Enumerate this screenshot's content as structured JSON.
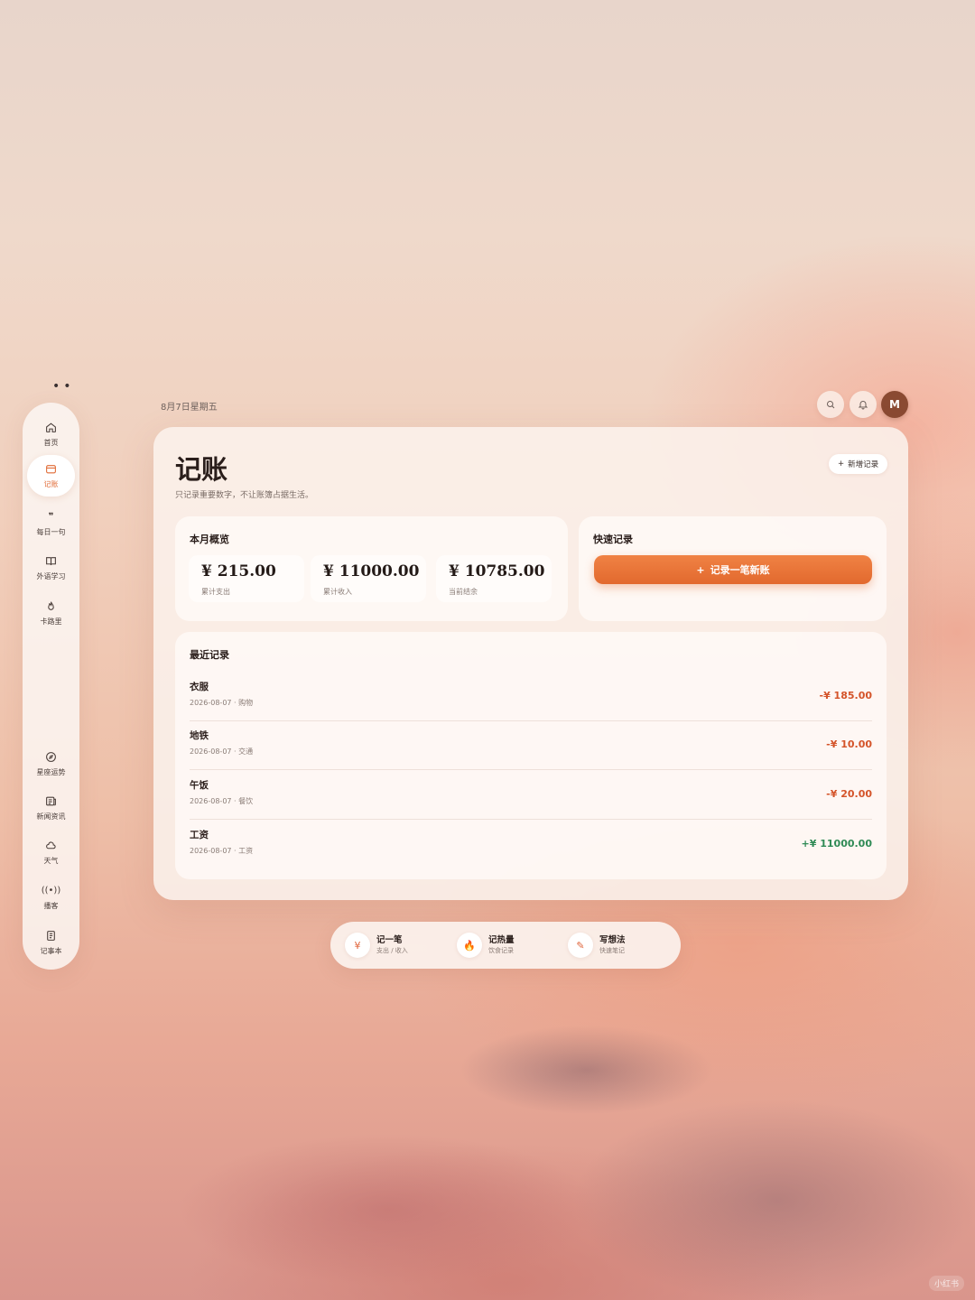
{
  "sidebar": {
    "items": [
      {
        "label": "首页",
        "icon": "home-icon",
        "active": false
      },
      {
        "label": "记账",
        "icon": "wallet-icon",
        "active": true
      },
      {
        "label": "每日一句",
        "icon": "quote-icon",
        "active": false
      },
      {
        "label": "外语学习",
        "icon": "book-icon",
        "active": false
      },
      {
        "label": "卡路里",
        "icon": "flame-icon",
        "active": false
      },
      {
        "label": "星座运势",
        "icon": "compass-icon",
        "active": false
      },
      {
        "label": "新闻资讯",
        "icon": "newspaper-icon",
        "active": false
      },
      {
        "label": "天气",
        "icon": "cloud-icon",
        "active": false
      },
      {
        "label": "播客",
        "icon": "broadcast-icon",
        "active": false
      },
      {
        "label": "记事本",
        "icon": "notebook-icon",
        "active": false
      }
    ]
  },
  "header": {
    "date": "8月7日星期五",
    "avatar_initial": "M",
    "search_icon": "search-icon",
    "bell_icon": "bell-icon"
  },
  "page": {
    "title": "记账",
    "subtitle": "只记录重要数字，不让账簿占据生活。",
    "add_button": "新增记录",
    "add_button_icon": "+"
  },
  "overview": {
    "title": "本月概览",
    "stats": [
      {
        "value": "¥ 215.00",
        "label": "累计支出"
      },
      {
        "value": "¥ 11000.00",
        "label": "累计收入"
      },
      {
        "value": "¥ 10785.00",
        "label": "当前结余"
      }
    ]
  },
  "quick": {
    "title": "快速记录",
    "cta_label": "记录一笔新账",
    "cta_icon": "+"
  },
  "recent": {
    "title": "最近记录",
    "items": [
      {
        "title": "衣服",
        "meta": "2026-08-07 · 购物",
        "amount": "-¥ 185.00",
        "type": "expense"
      },
      {
        "title": "地铁",
        "meta": "2026-08-07 · 交通",
        "amount": "-¥ 10.00",
        "type": "expense"
      },
      {
        "title": "午饭",
        "meta": "2026-08-07 · 餐饮",
        "amount": "-¥ 20.00",
        "type": "expense"
      },
      {
        "title": "工资",
        "meta": "2026-08-07 · 工资",
        "amount": "+¥ 11000.00",
        "type": "income"
      }
    ]
  },
  "quickbar": {
    "items": [
      {
        "title": "记一笔",
        "sub": "支出 / 收入",
        "icon": "yen-icon",
        "glyph": "¥"
      },
      {
        "title": "记热量",
        "sub": "饮食记录",
        "icon": "flame-icon",
        "glyph": "🔥"
      },
      {
        "title": "写想法",
        "sub": "快速笔记",
        "icon": "pen-icon",
        "glyph": "✎"
      }
    ]
  },
  "watermark": "小红书",
  "colors": {
    "accent": "#e8702f",
    "expense": "#d4542a",
    "income": "#2f8a55"
  }
}
